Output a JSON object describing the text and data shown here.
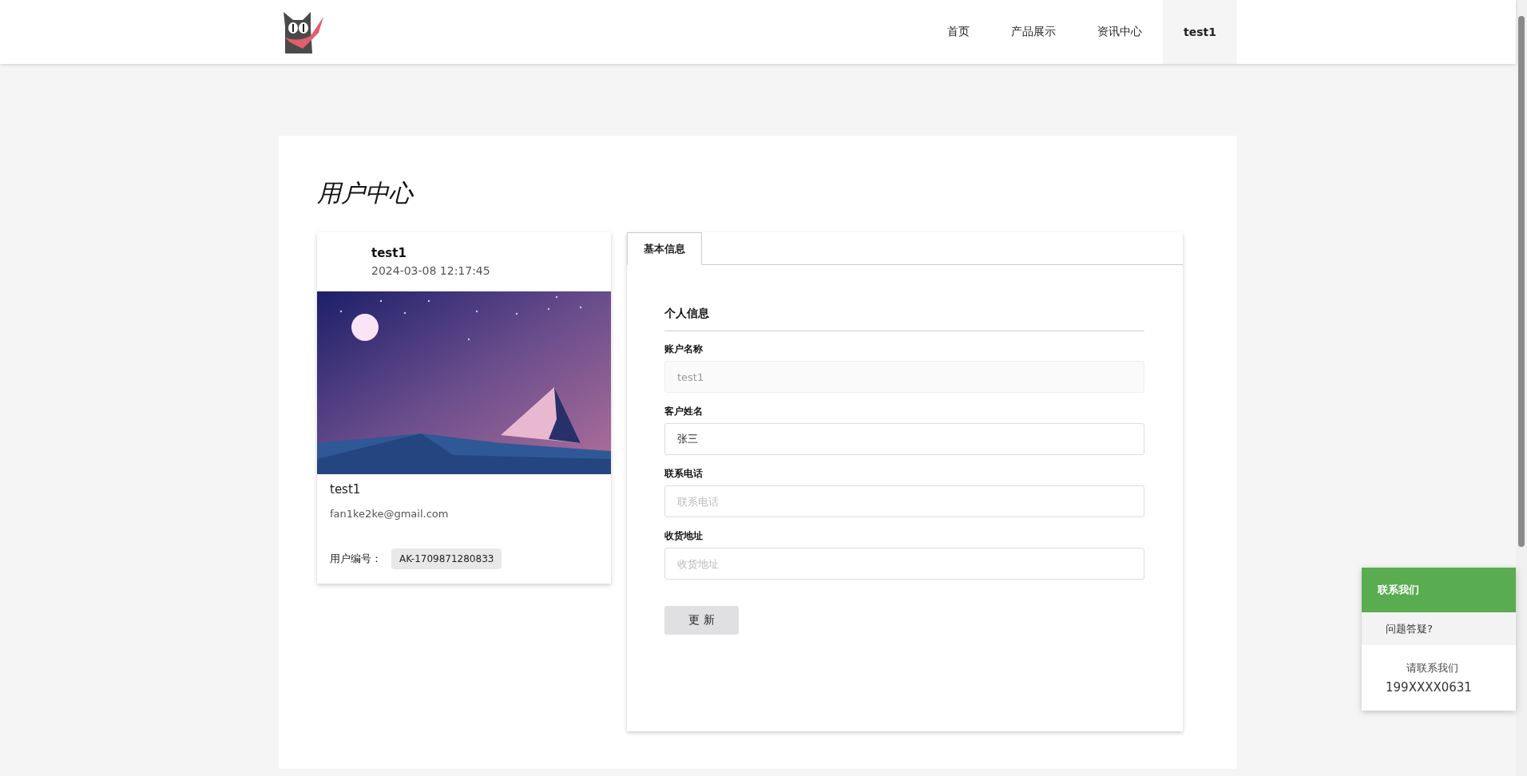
{
  "nav": {
    "items": [
      {
        "label": "首页",
        "selected": false
      },
      {
        "label": "产品展示",
        "selected": false
      },
      {
        "label": "资讯中心",
        "selected": false
      },
      {
        "label": "test1",
        "selected": true
      }
    ]
  },
  "page_title": "用户中心",
  "profile_card": {
    "username": "test1",
    "created": "2024-03-08 12:17:45",
    "name": "test1",
    "email": "fan1ke2ke@gmail.com",
    "user_id_label": "用户编号：",
    "user_id": "AK-1709871280833"
  },
  "tabs": [
    {
      "label": "基本信息",
      "selected": true
    }
  ],
  "form": {
    "section_title": "个人信息",
    "fields": [
      {
        "label": "账户名称",
        "value": "test1",
        "disabled": true
      },
      {
        "label": "客户姓名",
        "value": "张三",
        "disabled": false
      },
      {
        "label": "联系电话",
        "placeholder": "联系电话",
        "disabled": false
      },
      {
        "label": "收货地址",
        "placeholder": "收货地址",
        "disabled": false
      }
    ],
    "submit": "更 新"
  },
  "contact": {
    "title": "联系我们",
    "question": "问题答疑?",
    "prompt": "请联系我们",
    "phone": "199XXXX0631"
  }
}
